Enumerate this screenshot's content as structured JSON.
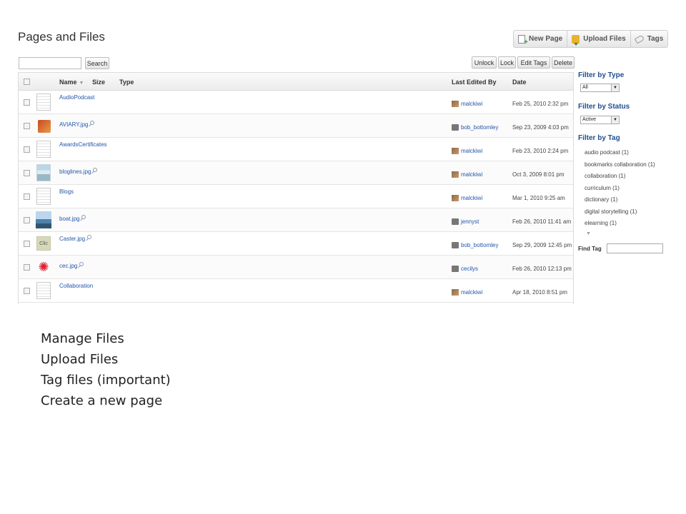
{
  "app": {
    "title": "Pages and Files"
  },
  "top_actions": [
    {
      "label": "New Page",
      "icon": "new-page-icon"
    },
    {
      "label": "Upload Files",
      "icon": "upload-icon"
    },
    {
      "label": "Tags",
      "icon": "tag-icon"
    }
  ],
  "search": {
    "value": "",
    "button_label": "Search"
  },
  "bulk_actions": {
    "unlock": "Unlock",
    "lock": "Lock",
    "edit_tags": "Edit Tags",
    "delete": "Delete"
  },
  "table": {
    "columns": {
      "name": "Name",
      "size": "Size",
      "type": "Type",
      "last_edited_by": "Last Edited By",
      "date": "Date"
    },
    "rows": [
      {
        "name": "AudioPodcast",
        "thumb": "document",
        "editor": "malckiwi",
        "editor_avatar": "photo",
        "date": "Feb 25, 2010 2:32 pm"
      },
      {
        "name": "AVIARY.jpg",
        "thumb": "image-bag",
        "editor": "bob_bottomley",
        "editor_avatar": "default",
        "date": "Sep 23, 2009 4:03 pm"
      },
      {
        "name": "AwardsCertificates",
        "thumb": "document",
        "editor": "malckiwi",
        "editor_avatar": "photo",
        "date": "Feb 23, 2010 2:24 pm"
      },
      {
        "name": "bloglines.jpg",
        "thumb": "image-blog",
        "editor": "malckiwi",
        "editor_avatar": "photo",
        "date": "Oct 3, 2009 8:01 pm"
      },
      {
        "name": "Blogs",
        "thumb": "document",
        "editor": "malckiwi",
        "editor_avatar": "photo",
        "date": "Mar 1, 2010 9:25 am"
      },
      {
        "name": "boat.jpg",
        "thumb": "image-boat",
        "editor": "jennyst",
        "editor_avatar": "default",
        "date": "Feb 26, 2010 11:41 am"
      },
      {
        "name": "Caster.jpg",
        "thumb": "image-caster",
        "thumb_text": "Clic",
        "editor": "bob_bottomley",
        "editor_avatar": "default",
        "date": "Sep 29, 2009 12:45 pm"
      },
      {
        "name": "cec.jpg",
        "thumb": "image-cec",
        "editor": "cecilys",
        "editor_avatar": "default",
        "date": "Feb 26, 2010 12:13 pm"
      },
      {
        "name": "Collaboration",
        "thumb": "document",
        "editor": "malckiwi",
        "editor_avatar": "photo",
        "date": "Apr 18, 2010 8:51 pm"
      }
    ]
  },
  "sidebar": {
    "filter_type": {
      "heading": "Filter by Type",
      "value": "All"
    },
    "filter_status": {
      "heading": "Filter by Status",
      "value": "Active"
    },
    "filter_tag": {
      "heading": "Filter by Tag",
      "tags": [
        "audio podcast (1)",
        "bookmarks collaboration (1)",
        "collaboration (1)",
        "curriculum (1)",
        "dictionary (1)",
        "digital storytelling (1)",
        "elearning (1)"
      ]
    },
    "find_tag": {
      "label": "Find Tag",
      "value": ""
    }
  },
  "notes": [
    "Manage Files",
    "Upload Files",
    "Tag files (important)",
    "Create a new page"
  ]
}
